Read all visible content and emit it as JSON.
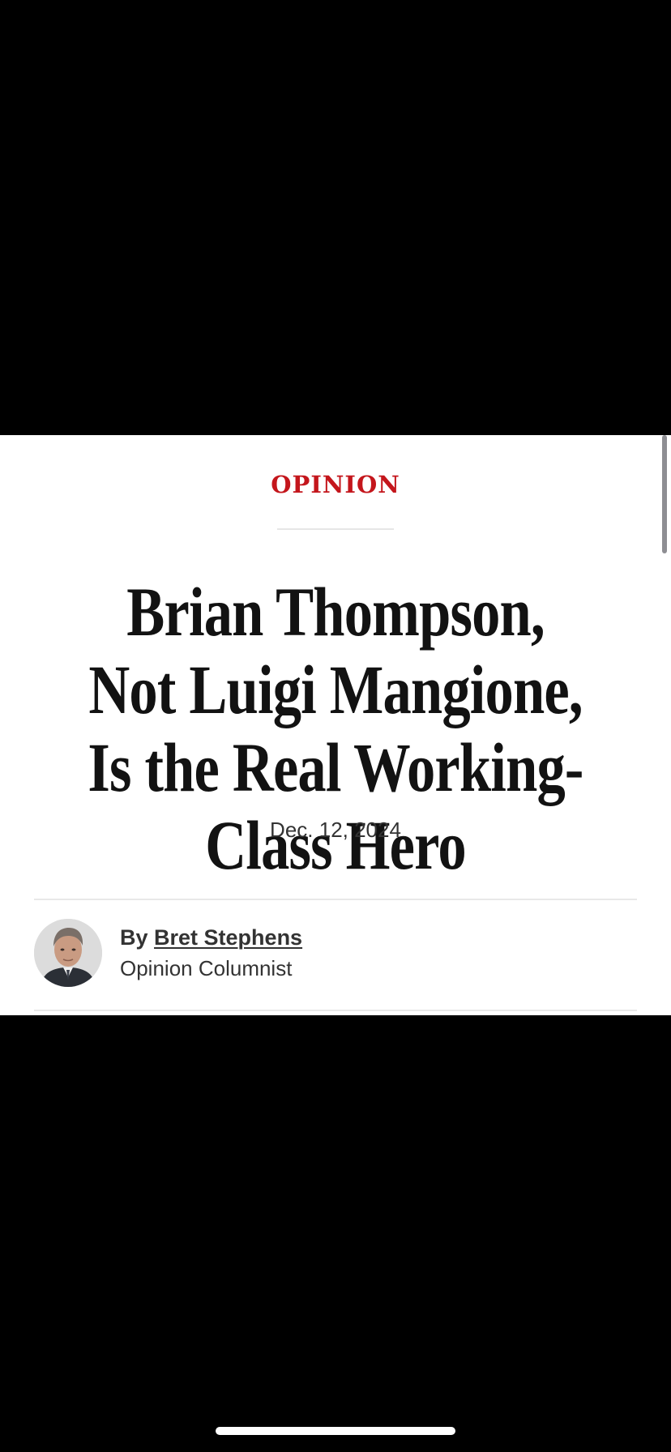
{
  "article": {
    "section": "OPINION",
    "headline": "Brian Thompson, Not Luigi Mangione, Is the Real Working-Class Hero",
    "date": "Dec. 12, 2024",
    "byline_prefix": "By",
    "author": "Bret Stephens",
    "author_role": "Opinion Columnist"
  },
  "colors": {
    "section_accent": "#c4161c",
    "headline_text": "#121212",
    "letterbox": "#000000",
    "card_background": "#ffffff"
  },
  "icons": {
    "avatar": "author-portrait"
  }
}
